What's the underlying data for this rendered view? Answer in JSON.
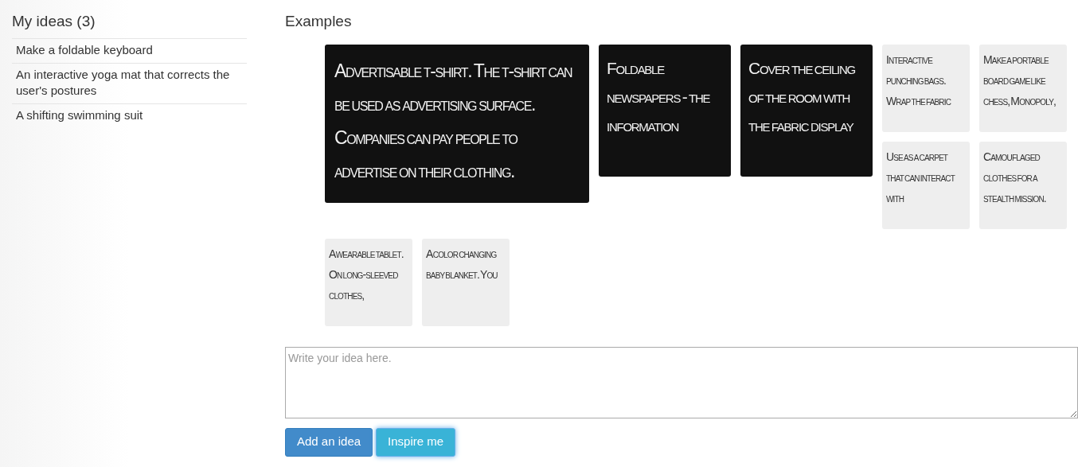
{
  "sidebar": {
    "title": "My ideas (3)",
    "ideas": [
      "Make a foldable keyboard",
      "An interactive yoga mat that corrects the user's postures",
      "A shifting swimming suit"
    ]
  },
  "examples": {
    "title": "Examples",
    "cards": [
      {
        "text": "Advertisable t-shirt. The t-shirt can be used as advertising surface. Companies can pay people to advertise on their clothing.",
        "kind": "large",
        "highlighted": true
      },
      {
        "text": "Foldable newspapers - the information",
        "kind": "medium",
        "highlighted": true
      },
      {
        "text": "Cover the ceiling of the room with the fabric display",
        "kind": "medium",
        "highlighted": true
      },
      {
        "text": "Interactive punching bags. Wrap the fabric",
        "kind": "small",
        "highlighted": false
      },
      {
        "text": "Make a portable board game like chess, Monopoly,",
        "kind": "small",
        "highlighted": false
      },
      {
        "text": "Use as a carpet that can interact with",
        "kind": "small",
        "highlighted": false
      },
      {
        "text": "Camouflaged clothes for a stealth mission.",
        "kind": "small",
        "highlighted": false
      },
      {
        "text": "A wearable tablet. On long-sleeved clothes,",
        "kind": "small",
        "highlighted": false
      },
      {
        "text": "A color changing baby blanket. You",
        "kind": "small",
        "highlighted": false
      }
    ]
  },
  "idea_field": {
    "placeholder": "Write your idea here."
  },
  "buttons": [
    {
      "label": "Add an idea",
      "kind": "primary"
    },
    {
      "label": "Inspire me",
      "kind": "info"
    }
  ]
}
